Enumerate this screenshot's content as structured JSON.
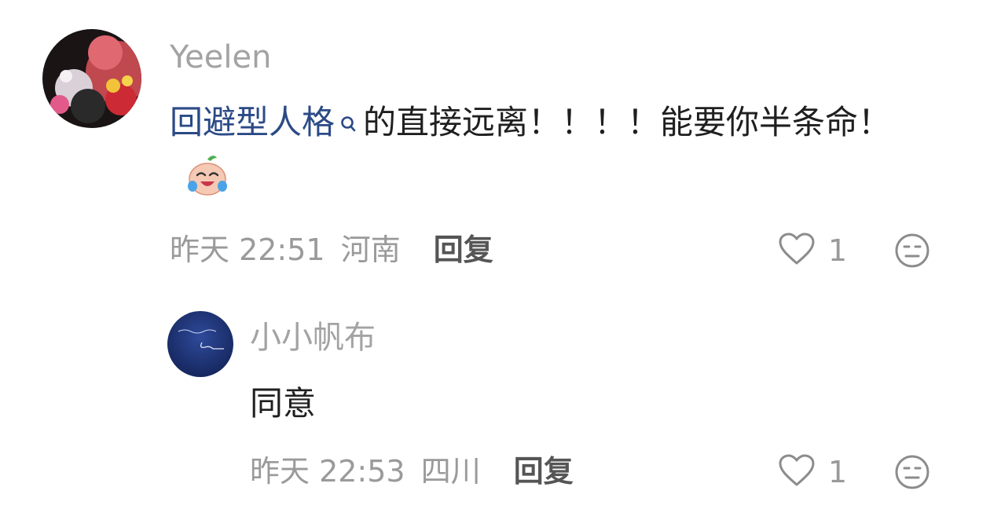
{
  "comments": [
    {
      "username": "Yeelen",
      "link_text": "回避型人格",
      "text_rest": "的直接远离！！！！能要你半条命！",
      "time": "昨天 22:51",
      "location": "河南",
      "reply_label": "回复",
      "likes": "1",
      "avatar_icon": "user-avatar",
      "emoji_icon": "laugh-cry-emoji"
    },
    {
      "username": "小小帆布",
      "text": "同意",
      "time": "昨天 22:53",
      "location": "四川",
      "reply_label": "回复",
      "likes": "1",
      "avatar_icon": "user-avatar"
    }
  ],
  "colors": {
    "link": "#2b4a86",
    "meta": "#9a9a9a",
    "username": "#a3a3a3"
  }
}
